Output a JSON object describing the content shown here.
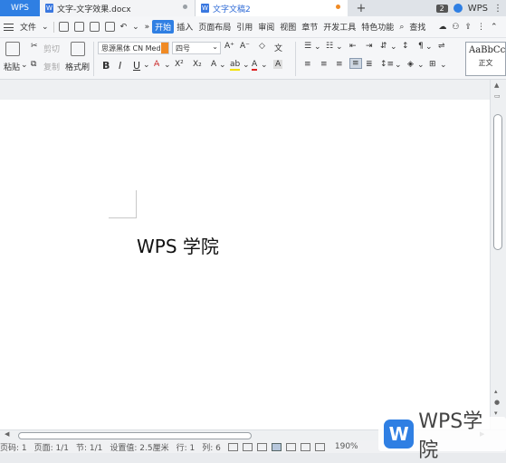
{
  "tabs": {
    "app": "WPS",
    "doc1": "文字-文字效果.docx",
    "doc2": "文字文稿2",
    "new_tab": "+",
    "count_badge": "2",
    "wps_right": "WPS"
  },
  "menubar": {
    "file": "文件",
    "items": [
      "开始",
      "插入",
      "页面布局",
      "引用",
      "审阅",
      "视图",
      "章节",
      "开发工具",
      "特色功能"
    ],
    "search": "查找"
  },
  "ribbon": {
    "paste": "粘贴",
    "cut": "剪切",
    "copy": "复制",
    "format_painter": "格式刷",
    "font_name": "思源黑体 CN Med",
    "font_size": "四号",
    "bold": "B",
    "italic": "I",
    "underline": "U",
    "style_preview": "AaBbCcI",
    "style_name": "正文"
  },
  "document": {
    "text": "WPS 学院"
  },
  "statusbar": {
    "page_code": "页码: 1",
    "page": "页面: 1/1",
    "section": "节: 1/1",
    "setting": "设置值: 2.5厘米",
    "line": "行: 1",
    "column": "列: 6",
    "zoom": "190%"
  },
  "watermark": {
    "text": "WPS学院"
  },
  "colors": {
    "accent": "#2f7fe3",
    "tab_modified": "#f08a24"
  }
}
